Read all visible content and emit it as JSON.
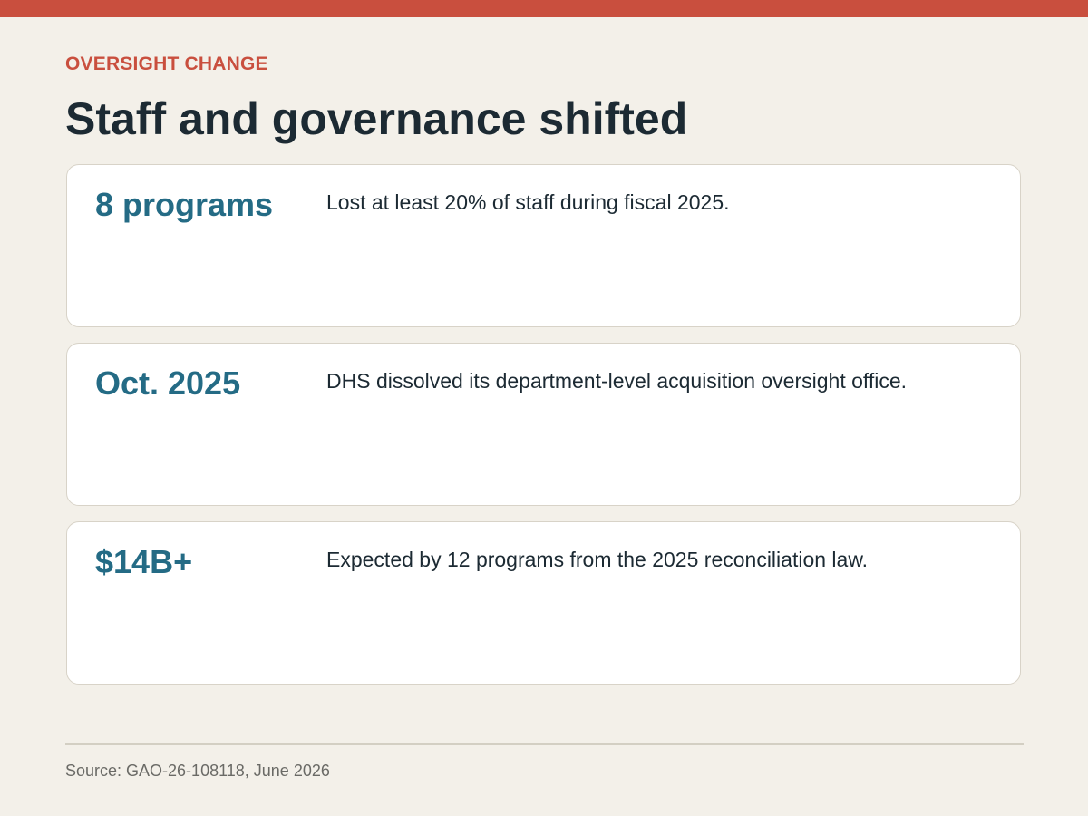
{
  "header": {
    "kicker": "OVERSIGHT CHANGE",
    "title": "Staff and governance shifted"
  },
  "cards": [
    {
      "stat": "8 programs",
      "description": "Lost at least 20% of staff during fiscal 2025."
    },
    {
      "stat": "Oct. 2025",
      "description": "DHS dissolved its department-level acquisition oversight office."
    },
    {
      "stat": "$14B+",
      "description": "Expected by 12 programs from the 2025 reconciliation law."
    }
  ],
  "footer": {
    "source": "Source: GAO-26-108118, June 2026"
  },
  "colors": {
    "accent": "#c94f3e",
    "stat": "#246b85",
    "text": "#1c2a33",
    "background": "#f3f0e9"
  }
}
